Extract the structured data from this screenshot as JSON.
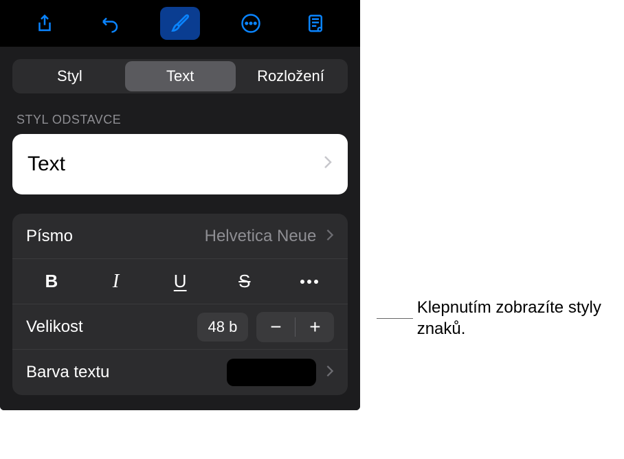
{
  "toolbar": {
    "icons": [
      "share",
      "undo",
      "format",
      "more",
      "document-view"
    ]
  },
  "tabs": {
    "style": "Styl",
    "text": "Text",
    "layout": "Rozložení"
  },
  "section": {
    "paragraph_style_label": "STYL ODSTAVCE",
    "paragraph_style_value": "Text"
  },
  "font": {
    "label": "Písmo",
    "value": "Helvetica Neue"
  },
  "styles": {
    "bold": "B",
    "italic": "I",
    "underline": "U",
    "strike": "S"
  },
  "size": {
    "label": "Velikost",
    "value": "48 b",
    "minus": "−",
    "plus": "+"
  },
  "color": {
    "label": "Barva textu",
    "value": "#000000"
  },
  "callout": {
    "text": "Klepnutím zobrazíte styly znaků."
  }
}
